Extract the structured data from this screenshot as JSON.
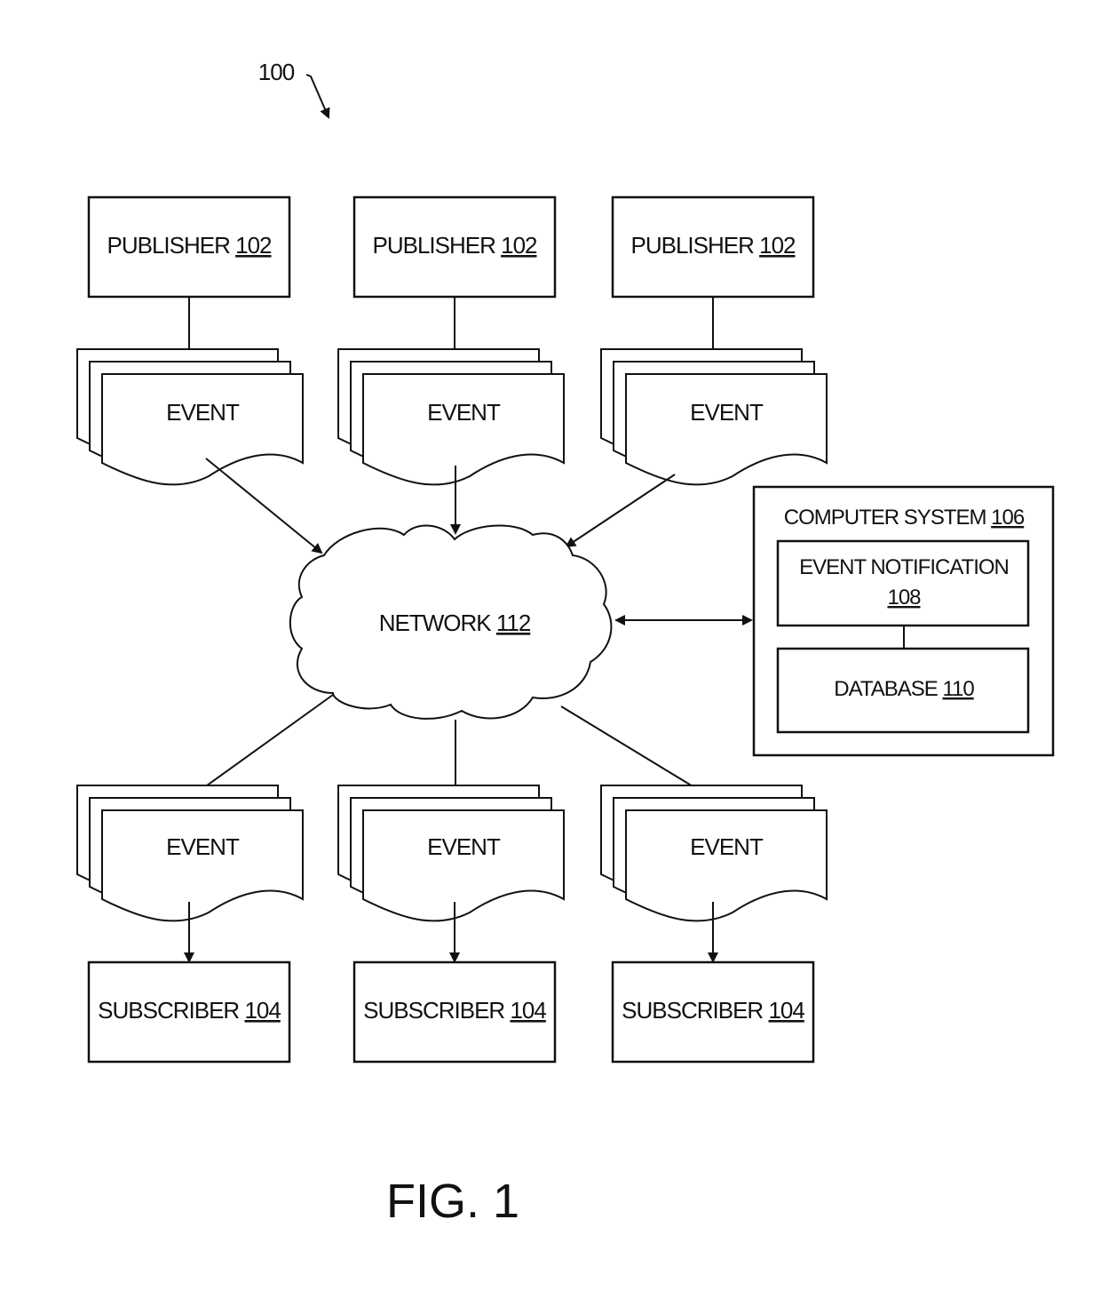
{
  "figure": {
    "reference_numeral": "100",
    "caption": "FIG. 1"
  },
  "publishers": [
    {
      "label": "PUBLISHER",
      "ref": "102"
    },
    {
      "label": "PUBLISHER",
      "ref": "102"
    },
    {
      "label": "PUBLISHER",
      "ref": "102"
    }
  ],
  "publisher_events": [
    {
      "label": "EVENT"
    },
    {
      "label": "EVENT"
    },
    {
      "label": "EVENT"
    }
  ],
  "network": {
    "label": "NETWORK",
    "ref": "112"
  },
  "computer_system": {
    "label": "COMPUTER SYSTEM",
    "ref": "106",
    "event_notification": {
      "label": "EVENT NOTIFICATION",
      "ref": "108"
    },
    "database": {
      "label": "DATABASE",
      "ref": "110"
    }
  },
  "subscriber_events": [
    {
      "label": "EVENT"
    },
    {
      "label": "EVENT"
    },
    {
      "label": "EVENT"
    }
  ],
  "subscribers": [
    {
      "label": "SUBSCRIBER",
      "ref": "104"
    },
    {
      "label": "SUBSCRIBER",
      "ref": "104"
    },
    {
      "label": "SUBSCRIBER",
      "ref": "104"
    }
  ],
  "colors": {
    "ink": "#111111",
    "paper": "#ffffff"
  }
}
